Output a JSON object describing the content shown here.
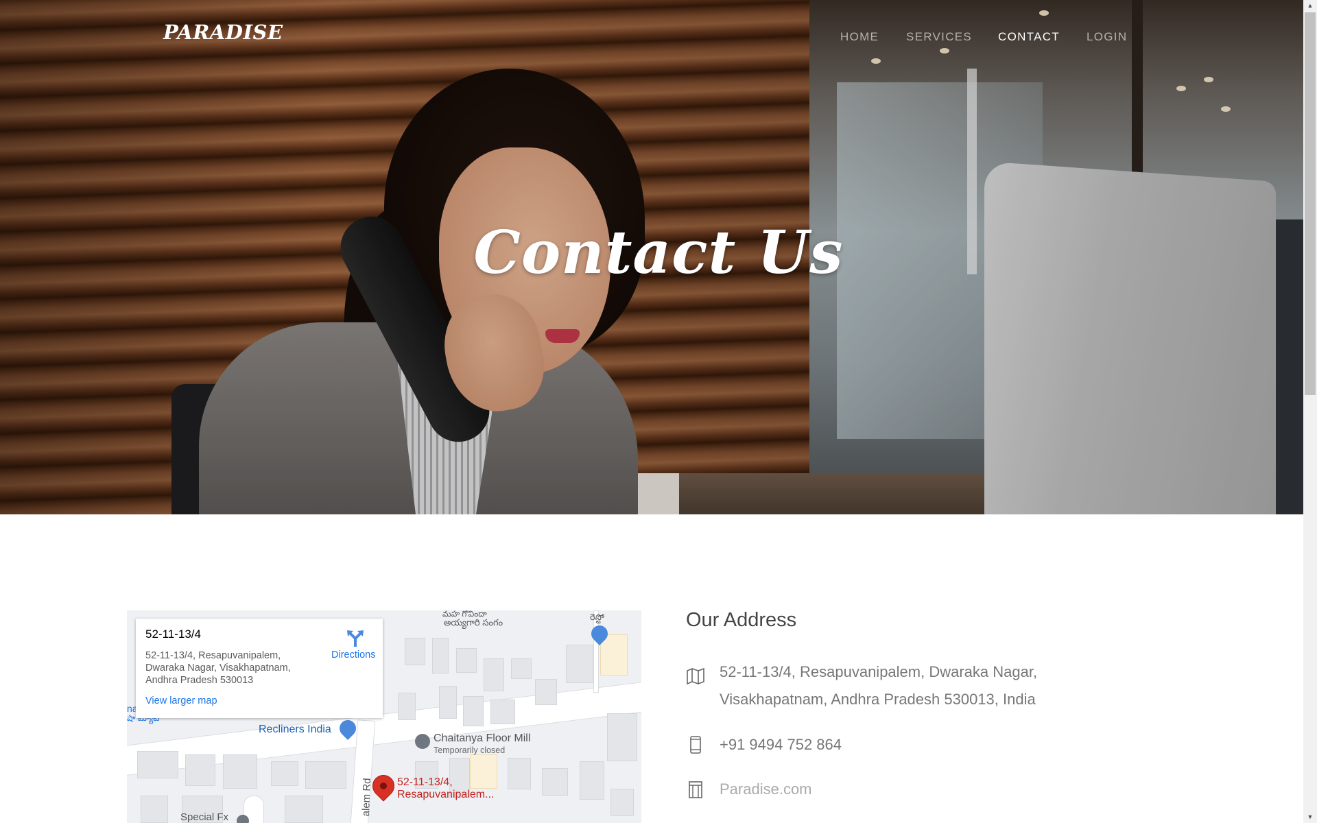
{
  "nav": {
    "logo": "PARADISE",
    "items": [
      {
        "label": "HOME"
      },
      {
        "label": "SERVICES"
      },
      {
        "label": "CONTACT"
      },
      {
        "label": "LOGIN"
      }
    ]
  },
  "hero": {
    "title": "Contact Us"
  },
  "map": {
    "card": {
      "title": "52-11-13/4",
      "address": "52-11-13/4, Resapuvanipalem, Dwaraka Nagar, Visakhapatnam, Andhra Pradesh 530013",
      "directions_label": "Directions",
      "larger_map_link": "View larger map"
    },
    "labels": {
      "recliners": "Recliners India",
      "mill": "Chaitanya Floor Mill",
      "mill_status": "Temporarily closed",
      "pin_line1": "52-11-13/4,",
      "pin_line2": "Resapuvanipalem...",
      "special": "Special Fx",
      "road": "alem Rd",
      "top_telugu1": "మహ గోవిందా",
      "top_telugu2": "అయ్యగారి సంగం",
      "top_right": "రెస్టో",
      "left_fragment": "na",
      "left_telugu": "షా బ్యూటీ"
    },
    "colors": {
      "pin_red": "#d93025",
      "pin_blue": "#4a89dc",
      "link_blue": "#1a73e8"
    }
  },
  "address": {
    "heading": "Our Address",
    "street_line1": "52-11-13/4, Resapuvanipalem, Dwaraka Nagar,",
    "street_line2": "Visakhapatnam, Andhra Pradesh 530013, India",
    "phone": "+91 9494 752 864",
    "website": "Paradise.com"
  }
}
